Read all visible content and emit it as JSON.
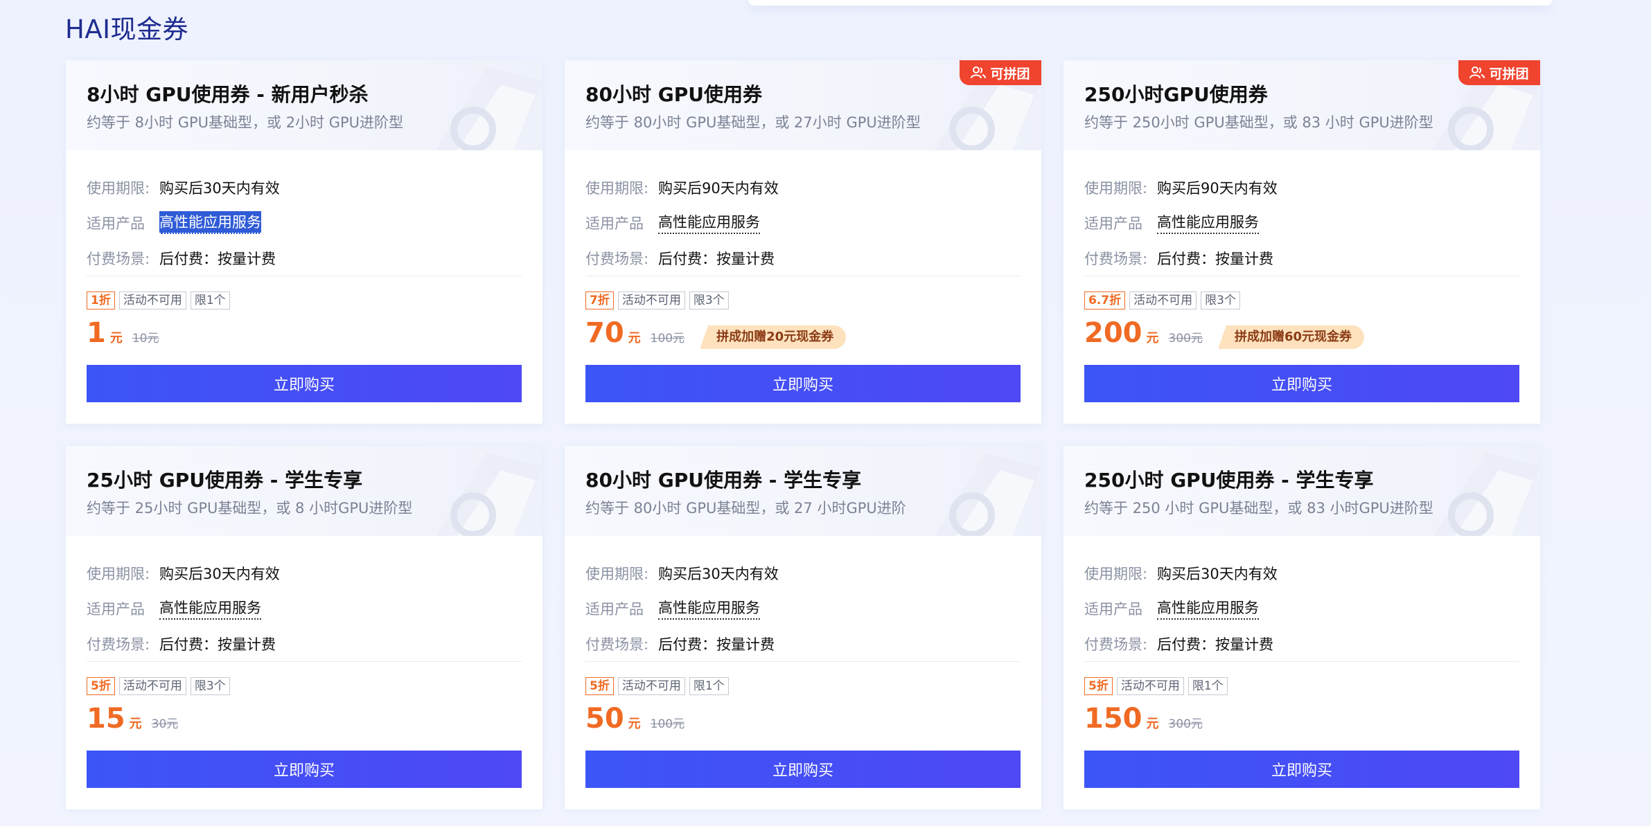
{
  "section_title": "HAI现金券",
  "labels": {
    "validity": "使用期限:",
    "product": "适用产品",
    "billing": "付费场景:"
  },
  "cards": [
    {
      "title": "8小时 GPU使用券 - 新用户秒杀",
      "subtitle": "约等于 8小时 GPU基础型，或 2小时 GPU进阶型",
      "validity": "购买后30天内有效",
      "product": "高性能应用服务",
      "billing": "后付费：按量计费",
      "discount": "1折",
      "activity": "活动不可用",
      "limit": "限1个",
      "price": "1",
      "unit": "元",
      "original": "10元",
      "promo": "",
      "group_badge": "",
      "button": "立即购买"
    },
    {
      "title": "80小时 GPU使用券",
      "subtitle": "约等于 80小时 GPU基础型，或 27小时 GPU进阶型",
      "validity": "购买后90天内有效",
      "product": "高性能应用服务",
      "billing": "后付费：按量计费",
      "discount": "7折",
      "activity": "活动不可用",
      "limit": "限3个",
      "price": "70",
      "unit": "元",
      "original": "100元",
      "promo": "拼成加赠20元现金券",
      "group_badge": "可拼团",
      "button": "立即购买"
    },
    {
      "title": "250小时GPU使用券",
      "subtitle": "约等于 250小时 GPU基础型，或 83 小时 GPU进阶型",
      "validity": "购买后90天内有效",
      "product": "高性能应用服务",
      "billing": "后付费：按量计费",
      "discount": "6.7折",
      "activity": "活动不可用",
      "limit": "限3个",
      "price": "200",
      "unit": "元",
      "original": "300元",
      "promo": "拼成加赠60元现金券",
      "group_badge": "可拼团",
      "button": "立即购买"
    },
    {
      "title": "25小时 GPU使用券 - 学生专享",
      "subtitle": "约等于 25小时 GPU基础型，或 8 小时GPU进阶型",
      "validity": "购买后30天内有效",
      "product": "高性能应用服务",
      "billing": "后付费：按量计费",
      "discount": "5折",
      "activity": "活动不可用",
      "limit": "限3个",
      "price": "15",
      "unit": "元",
      "original": "30元",
      "promo": "",
      "group_badge": "",
      "button": "立即购买"
    },
    {
      "title": "80小时 GPU使用券 - 学生专享",
      "subtitle": "约等于 80小时 GPU基础型，或 27 小时GPU进阶",
      "validity": "购买后30天内有效",
      "product": "高性能应用服务",
      "billing": "后付费：按量计费",
      "discount": "5折",
      "activity": "活动不可用",
      "limit": "限1个",
      "price": "50",
      "unit": "元",
      "original": "100元",
      "promo": "",
      "group_badge": "",
      "button": "立即购买"
    },
    {
      "title": "250小时 GPU使用券 - 学生专享",
      "subtitle": "约等于 250 小时 GPU基础型，或 83 小时GPU进阶型",
      "validity": "购买后30天内有效",
      "product": "高性能应用服务",
      "billing": "后付费：按量计费",
      "discount": "5折",
      "activity": "活动不可用",
      "limit": "限1个",
      "price": "150",
      "unit": "元",
      "original": "300元",
      "promo": "",
      "group_badge": "",
      "button": "立即购买"
    }
  ],
  "icons": {
    "group": "group-users-icon",
    "decoration": "coupon-watermark-icon"
  },
  "colors": {
    "accent_orange": "#f06a23",
    "button_blue": "#3c55f7",
    "badge_red": "#f0442f",
    "promo_bg": "#fde2bd",
    "title_blue": "#1e2c8f"
  }
}
